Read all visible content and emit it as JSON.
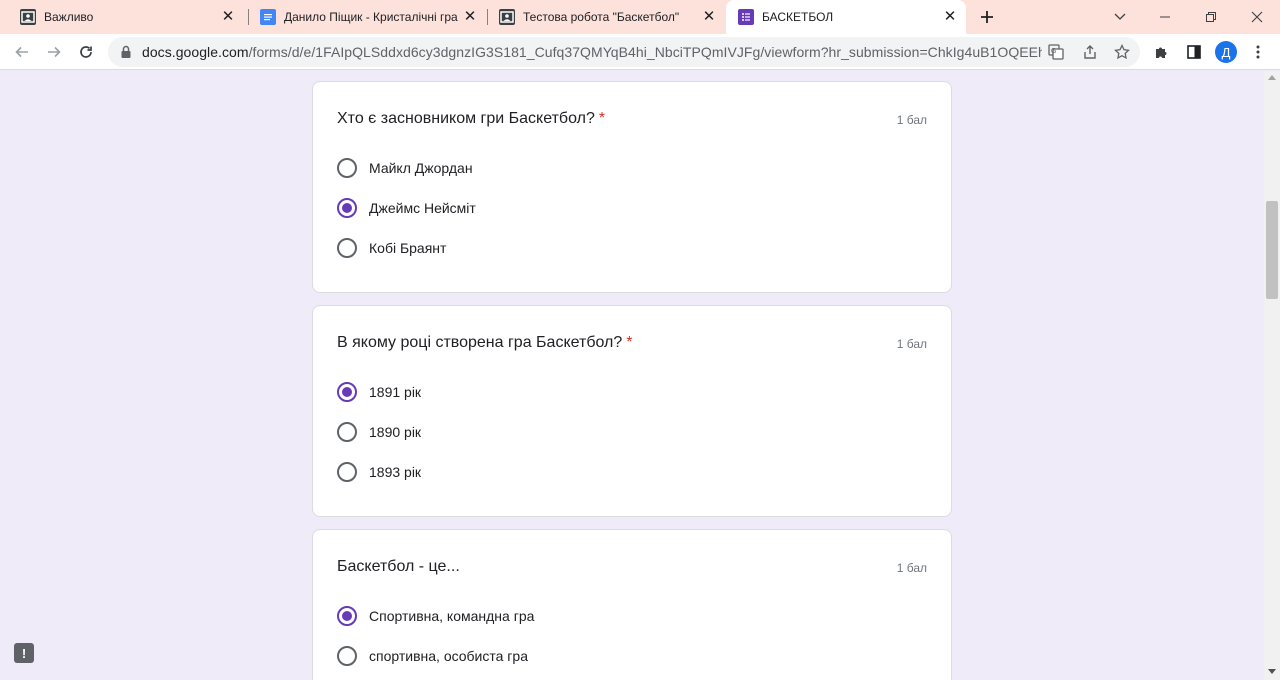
{
  "tabs": [
    {
      "title": "Важливо",
      "icon": "classroom-icon",
      "active": false
    },
    {
      "title": "Данило Піщик - Кристалічні гра",
      "icon": "docs-icon",
      "active": false
    },
    {
      "title": "Тестова робота \"Баскетбол\"",
      "icon": "classroom-icon",
      "active": false
    },
    {
      "title": "БАСКЕТБОЛ",
      "icon": "forms-icon",
      "active": true
    }
  ],
  "address_bar": {
    "host": "docs.google.com",
    "path": "/forms/d/e/1FAIpQLSddxd6cy3dgnzIG3S181_Cufq37QMYqB4hi_NbciTPQmIVJFg/viewform?hr_submission=ChkIg4uB1OQEEhAI..."
  },
  "profile": {
    "initial": "Д"
  },
  "colors": {
    "accent": "#673ab7",
    "background": "#f0ebf8",
    "required": "#d93025",
    "tabstrip": "#fde2db"
  },
  "questions": [
    {
      "title": "Хто є засновником гри Баскетбол?",
      "required_mark": "*",
      "points": "1 бал",
      "options": [
        {
          "label": "Майкл Джордан",
          "selected": false
        },
        {
          "label": "Джеймс Нейсміт",
          "selected": true
        },
        {
          "label": "Кобі Браянт",
          "selected": false
        }
      ]
    },
    {
      "title": "В якому році створена гра Баскетбол?",
      "required_mark": "*",
      "points": "1 бал",
      "options": [
        {
          "label": "1891 рік",
          "selected": true
        },
        {
          "label": "1890 рік",
          "selected": false
        },
        {
          "label": "1893 рік",
          "selected": false
        }
      ]
    },
    {
      "title": "Баскетбол - це...",
      "required_mark": "",
      "points": "1 бал",
      "options": [
        {
          "label": "Спортивна, командна гра",
          "selected": true
        },
        {
          "label": "спортивна, особиста гра",
          "selected": false
        }
      ]
    }
  ]
}
